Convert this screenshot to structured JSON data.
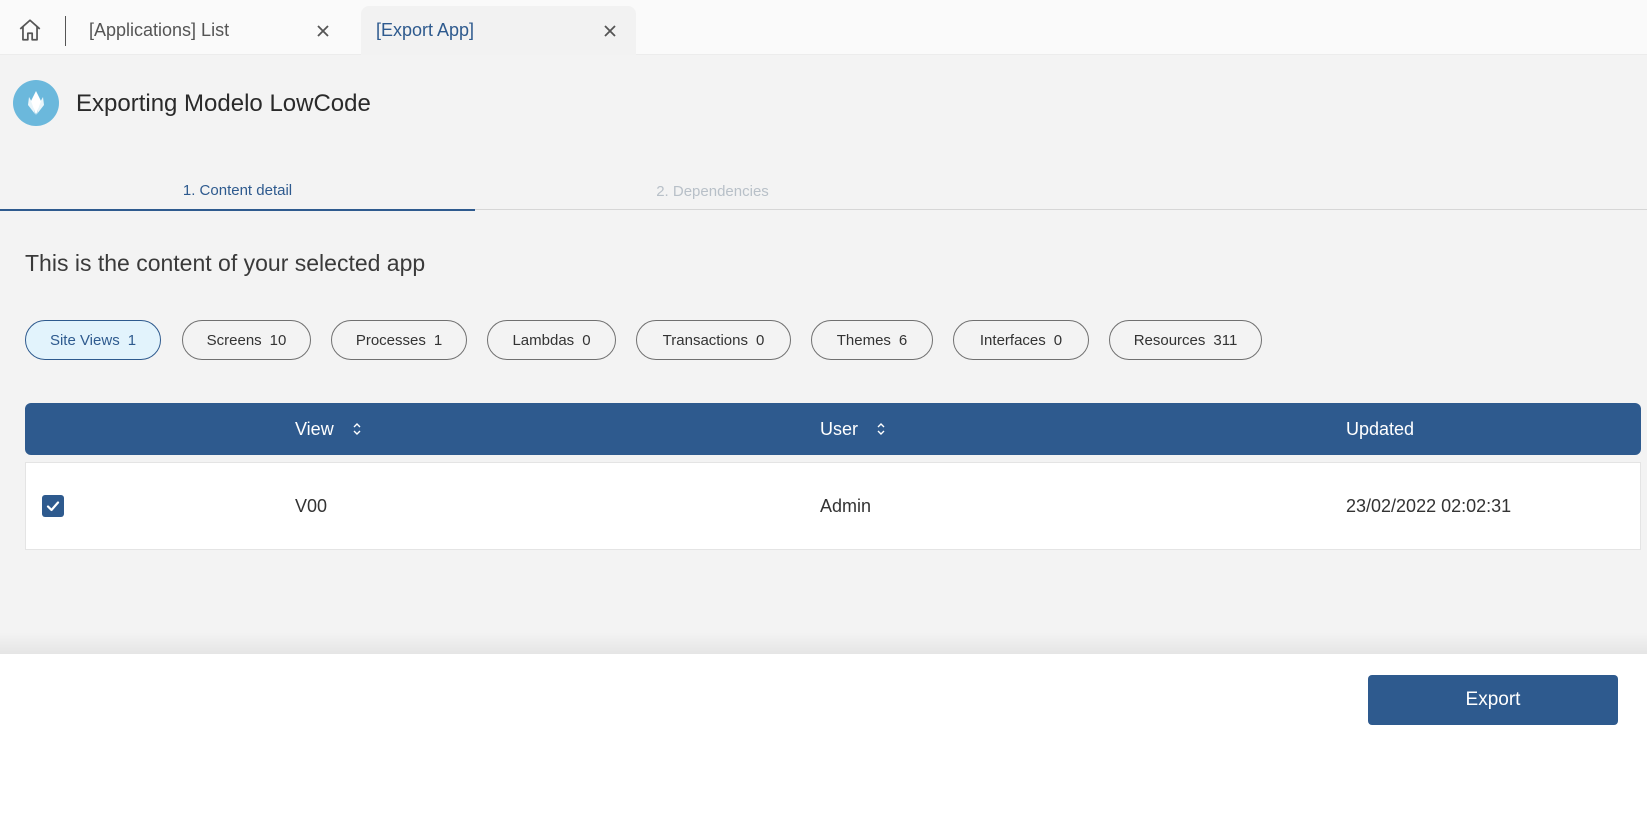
{
  "tabs": {
    "list_label": "[Applications] List",
    "export_label": "[Export App]"
  },
  "header": {
    "title": "Exporting Modelo LowCode"
  },
  "steps": [
    {
      "label": "1. Content detail",
      "active": true
    },
    {
      "label": "2. Dependencies",
      "active": false
    }
  ],
  "subtitle": "This is the content of your selected app",
  "chips": [
    {
      "label": "Site Views",
      "count": "1",
      "active": true
    },
    {
      "label": "Screens",
      "count": "10"
    },
    {
      "label": "Processes",
      "count": "1"
    },
    {
      "label": "Lambdas",
      "count": "0"
    },
    {
      "label": "Transactions",
      "count": "0"
    },
    {
      "label": "Themes",
      "count": "6"
    },
    {
      "label": "Interfaces",
      "count": "0"
    },
    {
      "label": "Resources",
      "count": "311"
    }
  ],
  "table": {
    "columns": {
      "view": "View",
      "user": "User",
      "updated": "Updated"
    },
    "rows": [
      {
        "checked": true,
        "view": "V00",
        "user": "Admin",
        "updated": "23/02/2022 02:02:31"
      }
    ]
  },
  "footer": {
    "export_label": "Export"
  },
  "colors": {
    "primary": "#2e5a8e",
    "chip_active_bg": "#e2f3fc",
    "logo": "#6bb8dc"
  }
}
